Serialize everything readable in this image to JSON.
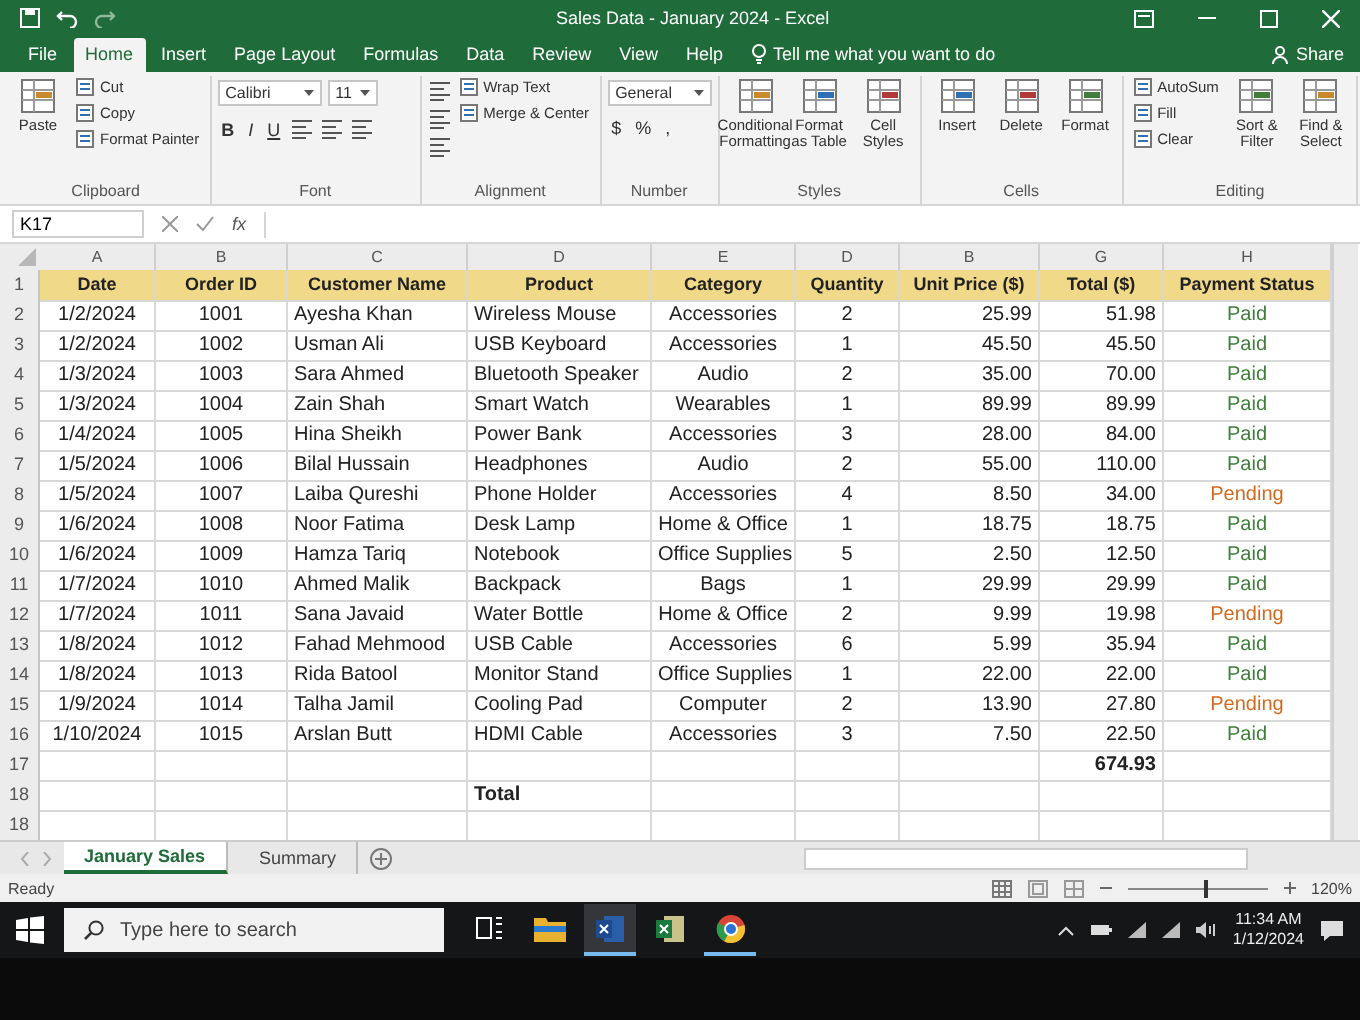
{
  "window": {
    "title": "Sales Data - January 2024  -  Excel",
    "share": "Share"
  },
  "ribbon_tabs": [
    {
      "label": "File",
      "selected": false
    },
    {
      "label": "Home",
      "selected": true
    },
    {
      "label": "Insert",
      "selected": false
    },
    {
      "label": "Page Layout",
      "selected": false
    },
    {
      "label": "Formulas",
      "selected": false
    },
    {
      "label": "Data",
      "selected": false
    },
    {
      "label": "Review",
      "selected": false
    },
    {
      "label": "View",
      "selected": false
    },
    {
      "label": "Help",
      "selected": false
    }
  ],
  "tell_me": "Tell me what you want to do",
  "ribbon": {
    "groups": [
      {
        "label": "Clipboard",
        "items": [
          {
            "kind": "large",
            "label": "Paste"
          },
          {
            "kind": "small",
            "label": "Cut"
          },
          {
            "kind": "small",
            "label": "Copy"
          },
          {
            "kind": "small",
            "label": "Format Painter"
          }
        ]
      },
      {
        "label": "Font",
        "items": [
          {
            "kind": "field",
            "label": "Calibri"
          },
          {
            "kind": "field",
            "label": "11"
          },
          {
            "kind": "bold",
            "label": "B"
          },
          {
            "kind": "italic",
            "label": "I"
          },
          {
            "kind": "underline",
            "label": "U"
          },
          {
            "kind": "icon"
          },
          {
            "kind": "icon"
          },
          {
            "kind": "icon"
          }
        ]
      },
      {
        "label": "Alignment",
        "items": [
          {
            "kind": "icon"
          },
          {
            "kind": "icon"
          },
          {
            "kind": "icon"
          },
          {
            "kind": "small",
            "label": "Wrap Text"
          },
          {
            "kind": "small",
            "label": "Merge & Center"
          }
        ]
      },
      {
        "label": "Number",
        "items": [
          {
            "kind": "field",
            "label": "General"
          },
          {
            "kind": "symbol",
            "label": "$"
          },
          {
            "kind": "symbol",
            "label": "%"
          },
          {
            "kind": "symbol",
            "label": ","
          }
        ]
      },
      {
        "label": "Styles",
        "items": [
          {
            "kind": "large",
            "label": "Conditional Formatting"
          },
          {
            "kind": "large",
            "label": "Format as Table"
          },
          {
            "kind": "large",
            "label": "Cell Styles"
          }
        ]
      },
      {
        "label": "Cells",
        "items": [
          {
            "kind": "large",
            "label": "Insert"
          },
          {
            "kind": "large",
            "label": "Delete"
          },
          {
            "kind": "large",
            "label": "Format"
          }
        ]
      },
      {
        "label": "Editing",
        "items": [
          {
            "kind": "small",
            "label": "AutoSum"
          },
          {
            "kind": "small",
            "label": "Fill"
          },
          {
            "kind": "small",
            "label": "Clear"
          },
          {
            "kind": "large",
            "label": "Sort & Filter"
          },
          {
            "kind": "large",
            "label": "Find & Select"
          }
        ]
      }
    ]
  },
  "formula_bar": {
    "name_box": "K17",
    "fx": "fx"
  },
  "sheet": {
    "column_letters": [
      "A",
      "B",
      "C",
      "D",
      "E",
      "D",
      "B",
      "G",
      "H"
    ],
    "header": {
      "number": "1",
      "cells": [
        "Date",
        "Order ID",
        "Customer Name",
        "Product",
        "Category",
        "Quantity",
        "Unit Price ($)",
        "Total ($)",
        "Payment Status"
      ]
    },
    "rows": [
      {
        "number": "2",
        "cells": [
          "1/2/2024",
          "1001",
          "Ayesha Khan",
          "Wireless Mouse",
          "Accessories",
          "2",
          "25.99",
          "51.98"
        ],
        "status": "Paid",
        "color": "#3f7f3a"
      },
      {
        "number": "3",
        "cells": [
          "1/2/2024",
          "1002",
          "Usman Ali",
          "USB Keyboard",
          "Accessories",
          "1",
          "45.50",
          "45.50"
        ],
        "status": "Paid",
        "color": "#3f7f3a"
      },
      {
        "number": "4",
        "cells": [
          "1/3/2024",
          "1003",
          "Sara Ahmed",
          "Bluetooth Speaker",
          "Audio",
          "2",
          "35.00",
          "70.00"
        ],
        "status": "Paid",
        "color": "#3f7f3a"
      },
      {
        "number": "5",
        "cells": [
          "1/3/2024",
          "1004",
          "Zain Shah",
          "Smart Watch",
          "Wearables",
          "1",
          "89.99",
          "89.99"
        ],
        "status": "Paid",
        "color": "#3f7f3a"
      },
      {
        "number": "6",
        "cells": [
          "1/4/2024",
          "1005",
          "Hina Sheikh",
          "Power Bank",
          "Accessories",
          "3",
          "28.00",
          "84.00"
        ],
        "status": "Paid",
        "color": "#3f7f3a"
      },
      {
        "number": "7",
        "cells": [
          "1/5/2024",
          "1006",
          "Bilal Hussain",
          "Headphones",
          "Audio",
          "2",
          "55.00",
          "110.00"
        ],
        "status": "Paid",
        "color": "#3f7f3a"
      },
      {
        "number": "8",
        "cells": [
          "1/5/2024",
          "1007",
          "Laiba Qureshi",
          "Phone Holder",
          "Accessories",
          "4",
          "8.50",
          "34.00"
        ],
        "status": "Pending",
        "color": "#d2691e"
      },
      {
        "number": "9",
        "cells": [
          "1/6/2024",
          "1008",
          "Noor Fatima",
          "Desk Lamp",
          "Home & Office",
          "1",
          "18.75",
          "18.75"
        ],
        "status": "Paid",
        "color": "#3f7f3a"
      },
      {
        "number": "10",
        "cells": [
          "1/6/2024",
          "1009",
          "Hamza Tariq",
          "Notebook",
          "Office Supplies",
          "5",
          "2.50",
          "12.50"
        ],
        "status": "Paid",
        "color": "#3f7f3a"
      },
      {
        "number": "11",
        "cells": [
          "1/7/2024",
          "1010",
          "Ahmed Malik",
          "Backpack",
          "Bags",
          "1",
          "29.99",
          "29.99"
        ],
        "status": "Paid",
        "color": "#3f7f3a"
      },
      {
        "number": "12",
        "cells": [
          "1/7/2024",
          "1011",
          "Sana Javaid",
          "Water Bottle",
          "Home & Office",
          "2",
          "9.99",
          "19.98"
        ],
        "status": "Pending",
        "color": "#d2691e"
      },
      {
        "number": "13",
        "cells": [
          "1/8/2024",
          "1012",
          "Fahad Mehmood",
          "USB Cable",
          "Accessories",
          "6",
          "5.99",
          "35.94"
        ],
        "status": "Paid",
        "color": "#3f7f3a"
      },
      {
        "number": "14",
        "cells": [
          "1/8/2024",
          "1013",
          "Rida Batool",
          "Monitor Stand",
          "Office Supplies",
          "1",
          "22.00",
          "22.00"
        ],
        "status": "Paid",
        "color": "#3f7f3a"
      },
      {
        "number": "15",
        "cells": [
          "1/9/2024",
          "1014",
          "Talha Jamil",
          "Cooling Pad",
          "Computer",
          "2",
          "13.90",
          "27.80"
        ],
        "status": "Pending",
        "color": "#d2691e"
      },
      {
        "number": "16",
        "cells": [
          "1/10/2024",
          "1015",
          "Arslan Butt",
          "HDMI Cable",
          "Accessories",
          "3",
          "7.50",
          "22.50"
        ],
        "status": "Paid",
        "color": "#3f7f3a"
      }
    ],
    "footer_rows": [
      {
        "number": "17",
        "total_value": "674.93"
      },
      {
        "number": "18",
        "total_label": "Total"
      },
      {
        "number": "18"
      }
    ]
  },
  "sheet_tabs": [
    {
      "label": "January Sales",
      "selected": true
    },
    {
      "label": "Summary",
      "selected": false
    }
  ],
  "status_bar": {
    "text": "Ready",
    "zoom": {
      "level": 0.55,
      "reading": "120%"
    }
  },
  "taskbar": {
    "search_placeholder": "Type here to search",
    "apps": [
      {
        "kind": "task-view",
        "open": false,
        "selected": false
      },
      {
        "kind": "folder",
        "open": false,
        "selected": false
      },
      {
        "kind": "word",
        "open": true,
        "selected": true
      },
      {
        "kind": "spreadsheet",
        "open": false,
        "selected": false
      },
      {
        "kind": "browser",
        "open": true,
        "selected": false
      }
    ],
    "time": "11:34 AM",
    "date": "1/12/2024"
  }
}
